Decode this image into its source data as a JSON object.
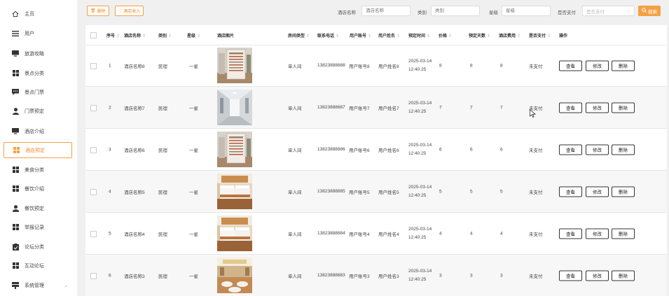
{
  "sidebar": {
    "items": [
      {
        "label": "主页",
        "icon": "home-icon"
      },
      {
        "label": "用户",
        "icon": "user-list-icon"
      },
      {
        "label": "旅游攻略",
        "icon": "monitor-icon"
      },
      {
        "label": "景点分类",
        "icon": "grid-icon"
      },
      {
        "label": "景点门票",
        "icon": "chat-icon"
      },
      {
        "label": "门票预定",
        "icon": "person-icon"
      },
      {
        "label": "酒店介绍",
        "icon": "monitor-icon"
      },
      {
        "label": "酒店预定",
        "icon": "grid-icon",
        "active": true
      },
      {
        "label": "美食分类",
        "icon": "grid-icon"
      },
      {
        "label": "餐饮介绍",
        "icon": "grid-icon"
      },
      {
        "label": "餐饮预定",
        "icon": "person-icon"
      },
      {
        "label": "举报记录",
        "icon": "grid-icon"
      },
      {
        "label": "论坛分类",
        "icon": "clipboard-icon"
      },
      {
        "label": "互动论坛",
        "icon": "grid-icon"
      },
      {
        "label": "系统管理",
        "icon": "stack-icon",
        "expandable": true
      }
    ]
  },
  "toolbar": {
    "delete_label": "删除",
    "revenue_label": "酒店收入",
    "hotel_name_label": "酒店名称",
    "hotel_name_placeholder": "酒店名称",
    "category_label": "类别",
    "category_placeholder": "类别",
    "star_label": "星级",
    "star_placeholder": "星级",
    "paid_label": "是否支付",
    "paid_placeholder": "是否支付",
    "search_label": "搜索"
  },
  "table": {
    "headers": {
      "index": "序号",
      "hotel_name": "酒店名称",
      "category": "类别",
      "star": "星级",
      "image": "酒店图片",
      "room_type": "房间类型",
      "phone": "联系电话",
      "account": "用户账号",
      "username": "用户姓名",
      "book_time": "预定时间",
      "price": "价格",
      "days": "预定天数",
      "cost": "酒店费用",
      "paid": "是否支付",
      "actions": "操作"
    },
    "rows": [
      {
        "index": "1",
        "hotel_name": "酒店名称8",
        "category": "民宿",
        "star": "一星",
        "room_type": "单人间",
        "phone": "13823888888",
        "account": "用户账号8",
        "username": "用户姓名8",
        "book_time": "2025-03-14 12:40:25",
        "price": "8",
        "days": "8",
        "cost": "8",
        "paid": "未支付",
        "image": "lobby-sign"
      },
      {
        "index": "2",
        "hotel_name": "酒店名称7",
        "category": "民宿",
        "star": "一星",
        "room_type": "单人间",
        "phone": "13823888887",
        "account": "用户账号7",
        "username": "用户姓名7",
        "book_time": "2025-03-14 12:40:25",
        "price": "7",
        "days": "7",
        "cost": "7",
        "paid": "未支付",
        "image": "corridor"
      },
      {
        "index": "3",
        "hotel_name": "酒店名称6",
        "category": "民宿",
        "star": "一星",
        "room_type": "单人间",
        "phone": "13823888886",
        "account": "用户账号6",
        "username": "用户姓名6",
        "book_time": "2025-03-14 12:40:25",
        "price": "6",
        "days": "6",
        "cost": "6",
        "paid": "未支付",
        "image": "lobby-sign"
      },
      {
        "index": "4",
        "hotel_name": "酒店名称5",
        "category": "民宿",
        "star": "一星",
        "room_type": "单人间",
        "phone": "13823888885",
        "account": "用户账号5",
        "username": "用户姓名5",
        "book_time": "2025-03-14 12:40:25",
        "price": "5",
        "days": "5",
        "cost": "5",
        "paid": "未支付",
        "image": "bedroom"
      },
      {
        "index": "5",
        "hotel_name": "酒店名称4",
        "category": "民宿",
        "star": "一星",
        "room_type": "单人间",
        "phone": "13823888884",
        "account": "用户账号4",
        "username": "用户姓名4",
        "book_time": "2025-03-14 12:40:25",
        "price": "4",
        "days": "4",
        "cost": "4",
        "paid": "未支付",
        "image": "bedroom"
      },
      {
        "index": "6",
        "hotel_name": "酒店名称3",
        "category": "民宿",
        "star": "一星",
        "room_type": "单人间",
        "phone": "13823888883",
        "account": "用户账号3",
        "username": "用户姓名3",
        "book_time": "2025-03-14 12:40:25",
        "price": "3",
        "days": "3",
        "cost": "3",
        "paid": "未支付",
        "image": "banquet-hall"
      }
    ],
    "actions": {
      "view": "查看",
      "edit": "修改",
      "delete": "删除"
    }
  },
  "colors": {
    "accent": "#f5a143",
    "accent_text": "#f08a2e",
    "row_alt": "#f7f7f7"
  }
}
